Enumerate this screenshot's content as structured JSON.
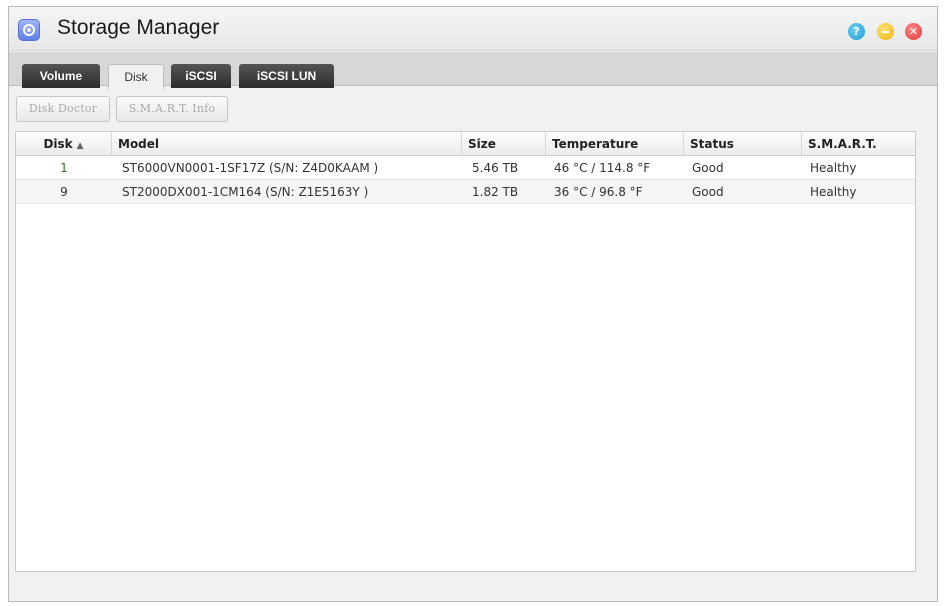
{
  "window": {
    "title": "Storage Manager",
    "icons": {
      "app": "storage-manager-icon",
      "help": "help-icon",
      "minimize": "minimize-icon",
      "close": "close-icon"
    },
    "help_glyph": "?",
    "close_glyph": "✕"
  },
  "tabs": [
    {
      "label": "Volume",
      "active": false
    },
    {
      "label": "Disk",
      "active": true
    },
    {
      "label": "iSCSI",
      "active": false
    },
    {
      "label": "iSCSI LUN",
      "active": false
    }
  ],
  "toolbar": {
    "disk_doctor_label": "Disk Doctor",
    "smart_info_label": "S.M.A.R.T. Info",
    "buttons_enabled": false
  },
  "table": {
    "columns": [
      "Disk",
      "Model",
      "Size",
      "Temperature",
      "Status",
      "S.M.A.R.T."
    ],
    "sort_column": "Disk",
    "sort_indicator": "▲",
    "rows": [
      {
        "disk": "1",
        "model": "ST6000VN0001-1SF17Z (S/N: Z4D0KAAM )",
        "size": "5.46 TB",
        "temperature": "46 °C / 114.8 °F",
        "status": "Good",
        "smart": "Healthy"
      },
      {
        "disk": "9",
        "model": "ST2000DX001-1CM164 (S/N: Z1E5163Y )",
        "size": "1.82 TB",
        "temperature": "36 °C / 96.8 °F",
        "status": "Good",
        "smart": "Healthy"
      }
    ]
  },
  "colors": {
    "active_tab_bg": "#f1f1f1",
    "inactive_tab_bg": "#2b2b2b",
    "help_button": "#1e9ad6",
    "minimize_button": "#f0b400",
    "close_button": "#e03434"
  }
}
